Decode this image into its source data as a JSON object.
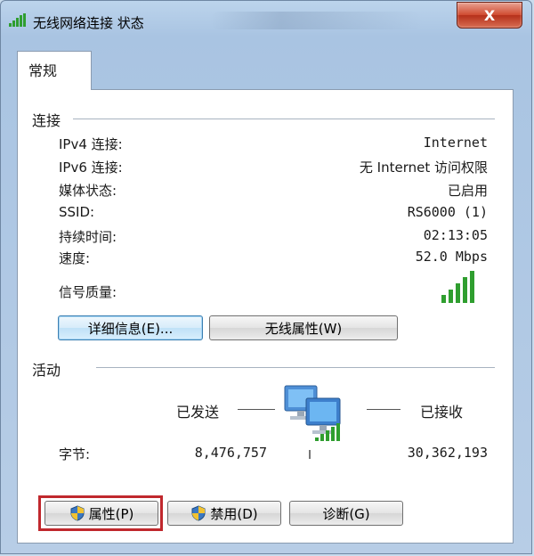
{
  "window": {
    "title": "无线网络连接 状态",
    "close_label": "X"
  },
  "tabs": [
    {
      "label": "常规"
    }
  ],
  "connection": {
    "group_label": "连接",
    "rows": [
      {
        "label": "IPv4 连接:",
        "value": "Internet"
      },
      {
        "label": "IPv6 连接:",
        "value": "无 Internet 访问权限"
      },
      {
        "label": "媒体状态:",
        "value": "已启用"
      },
      {
        "label": "SSID:",
        "value": "RS6000 (1)"
      },
      {
        "label": "持续时间:",
        "value": "02:13:05"
      },
      {
        "label": "速度:",
        "value": "52.0 Mbps"
      }
    ],
    "signal_label": "信号质量:",
    "signal_bars": 5,
    "details_button": "详细信息(E)...",
    "wireless_button": "无线属性(W)"
  },
  "activity": {
    "group_label": "活动",
    "sent_label": "已发送",
    "received_label": "已接收",
    "bytes_label": "字节:",
    "bytes_sent": "8,476,757",
    "bytes_received": "30,362,193"
  },
  "buttons": {
    "properties": "属性(P)",
    "disable": "禁用(D)",
    "diagnose": "诊断(G)"
  },
  "colors": {
    "signal_green": "#2f9e2f",
    "highlight": "#c0282d"
  }
}
